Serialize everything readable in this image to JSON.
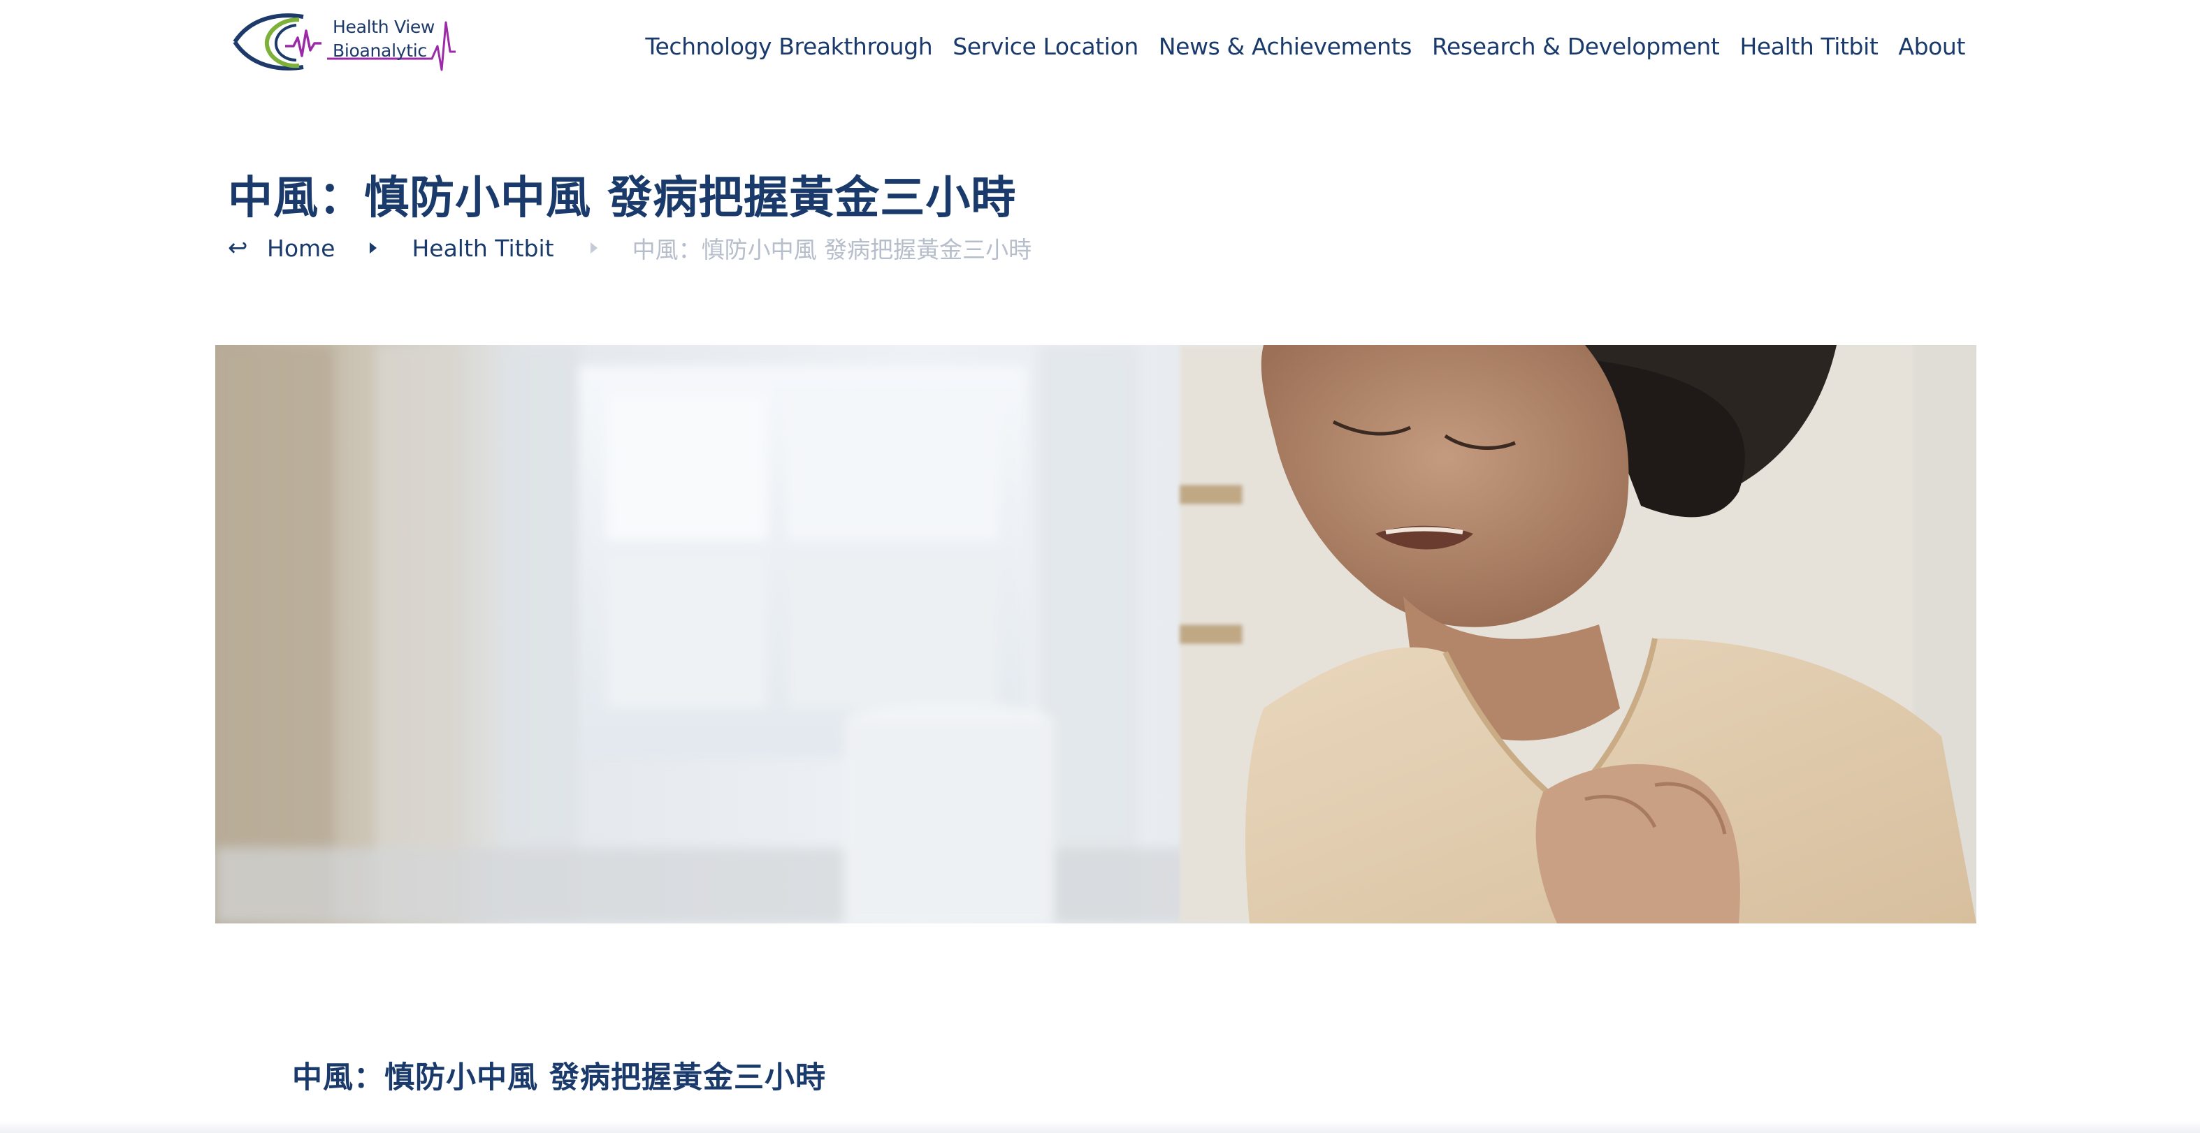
{
  "header": {
    "logo": {
      "line1": "Health View",
      "line2": "Bioanalytic",
      "colors": {
        "navy": "#1d3a6a",
        "purple": "#9b2aa6",
        "green": "#7db13a"
      }
    },
    "nav": [
      {
        "label": "Technology Breakthrough"
      },
      {
        "label": "Service Location"
      },
      {
        "label": "News & Achievements"
      },
      {
        "label": "Research & Development"
      },
      {
        "label": "Health Titbit"
      },
      {
        "label": "About"
      }
    ]
  },
  "page_title": "中風：慎防小中風 發病把握黃金三小時",
  "breadcrumb": {
    "back_icon": "return-arrow-icon",
    "home": "Home",
    "section": "Health Titbit",
    "current": "中風：慎防小中風 發病把握黃金三小時"
  },
  "hero_image": {
    "subject": "woman-clutching-chest-photo"
  },
  "article": {
    "title": "中風：慎防小中風 發病把握黃金三小時"
  },
  "colors": {
    "primary": "#1a3a6b",
    "muted": "#b6bdcb",
    "background": "#ffffff"
  }
}
